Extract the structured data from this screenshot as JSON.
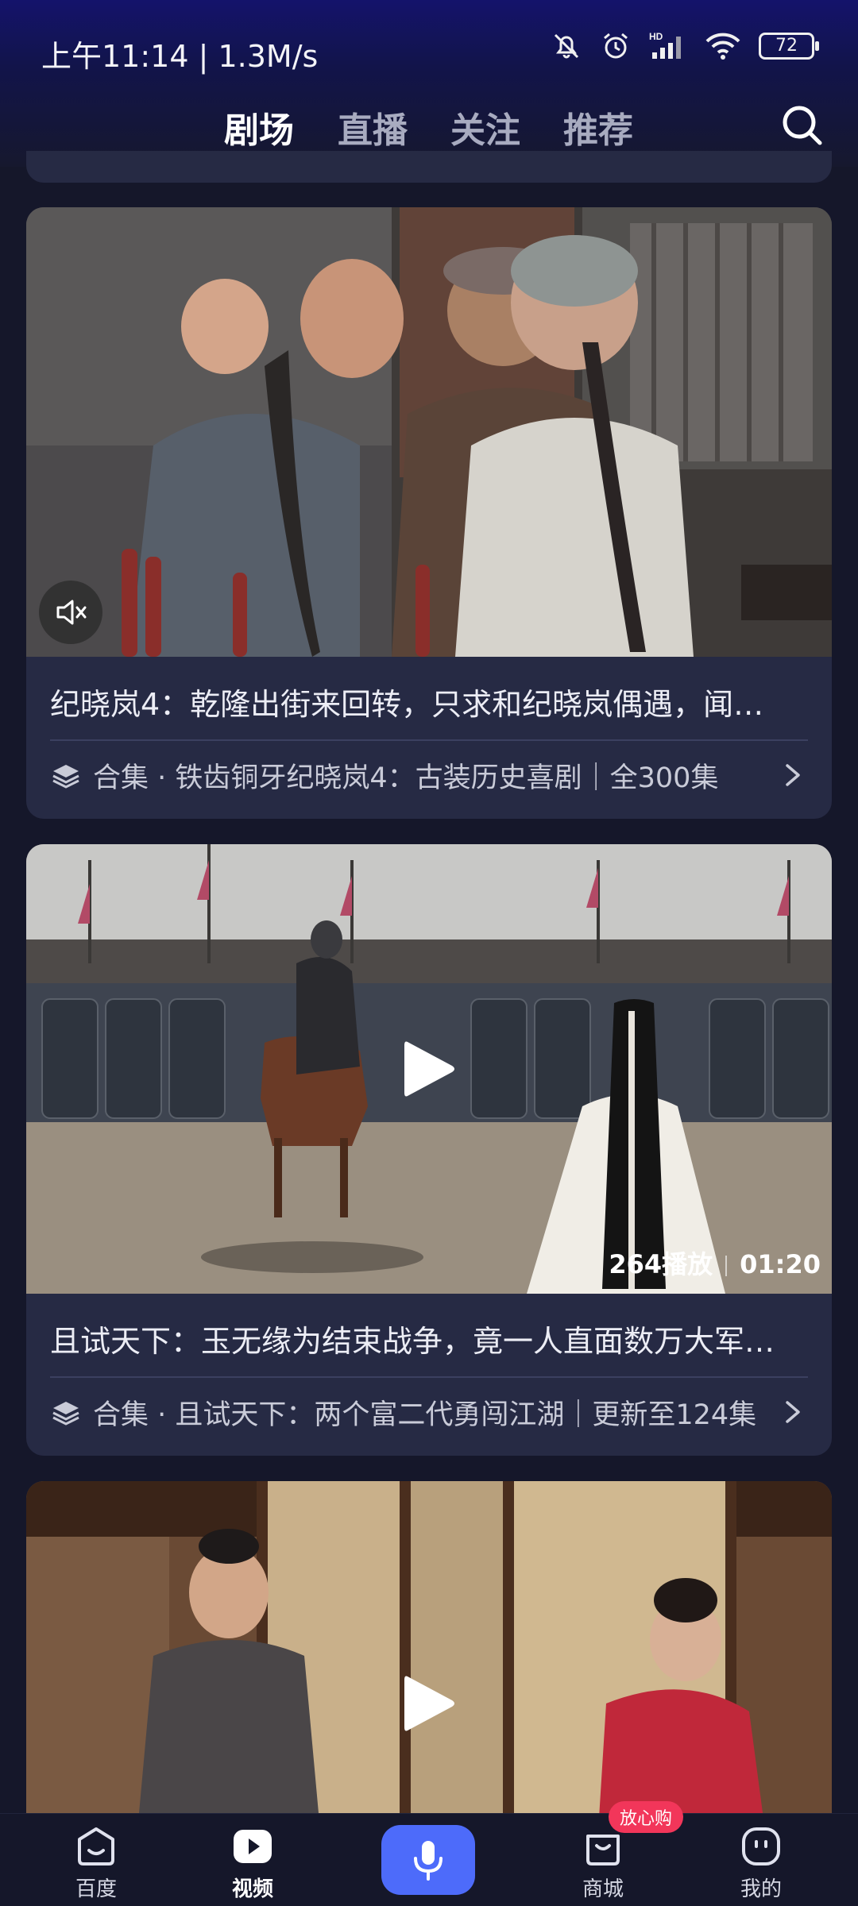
{
  "status_bar": {
    "time": "上午11:14",
    "net_speed": "1.3M/s",
    "battery": "72"
  },
  "tabs": [
    {
      "label": "剧场",
      "active": true
    },
    {
      "label": "直播",
      "active": false
    },
    {
      "label": "关注",
      "active": false
    },
    {
      "label": "推荐",
      "active": false
    }
  ],
  "feed": [
    {
      "title": "纪晓岚4：乾隆出街来回转，只求和纪晓岚偶遇，闻…",
      "collection": "合集 · 铁齿铜牙纪晓岚4：古装历史喜剧｜全300集",
      "muted": true
    },
    {
      "title": "且试天下：玉无缘为结束战争，竟一人直面数万大军…",
      "collection": "合集 · 且试天下：两个富二代勇闯江湖｜更新至124集",
      "plays": "264播放",
      "duration": "01:20"
    }
  ],
  "bottom_nav": {
    "home": "百度",
    "video": "视频",
    "mall": "商城",
    "mall_badge": "放心购",
    "me": "我的"
  },
  "colors": {
    "accent": "#4d6bfa",
    "badge": "#f2365a",
    "card": "#262a44",
    "background": "#15172a"
  }
}
